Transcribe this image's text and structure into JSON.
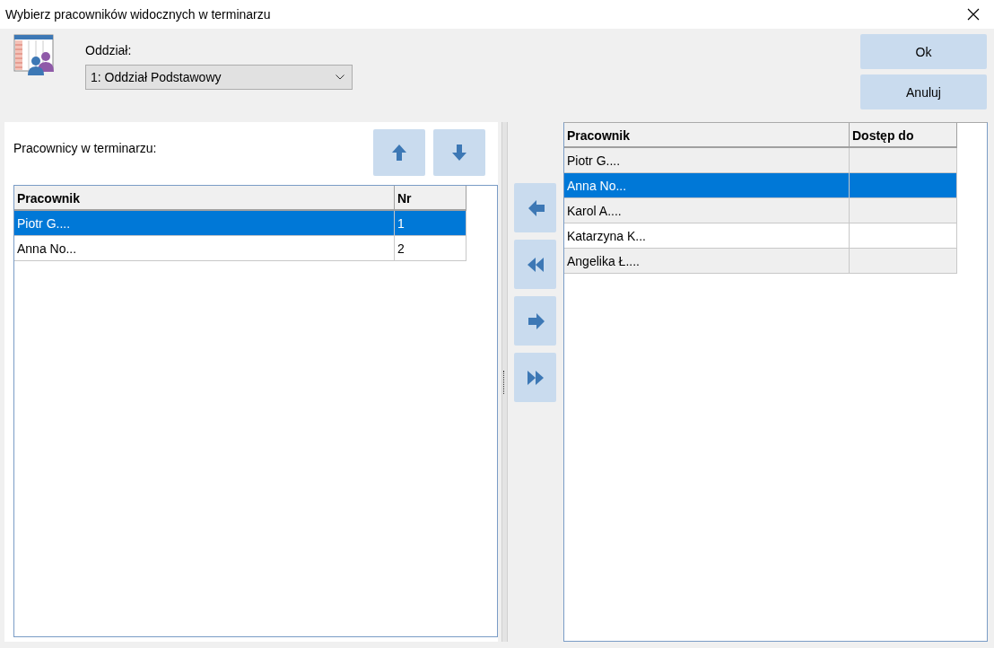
{
  "window": {
    "title": "Wybierz pracowników widocznych w terminarzu"
  },
  "department": {
    "label": "Oddział:",
    "value": "1: Oddział Podstawowy"
  },
  "buttons": [
    {
      "label": "Ok"
    },
    {
      "label": "Anuluj"
    }
  ],
  "visible_list": {
    "label": "Pracownicy w terminarzu:",
    "columns": [
      "Pracownik",
      "Nr"
    ],
    "rows": [
      {
        "name": "Piotr G....",
        "nr": "1",
        "selected": true
      },
      {
        "name": "Anna No...",
        "nr": "2",
        "selected": false
      }
    ]
  },
  "available_list": {
    "columns": [
      "Pracownik",
      "Dostęp do"
    ],
    "rows": [
      {
        "name": "Piotr G....",
        "selected": false
      },
      {
        "name": "Anna No...",
        "selected": true
      },
      {
        "name": "Karol A....",
        "selected": false
      },
      {
        "name": "Katarzyna K...",
        "selected": false
      },
      {
        "name": "Angelika Ł....",
        "selected": false
      }
    ]
  }
}
